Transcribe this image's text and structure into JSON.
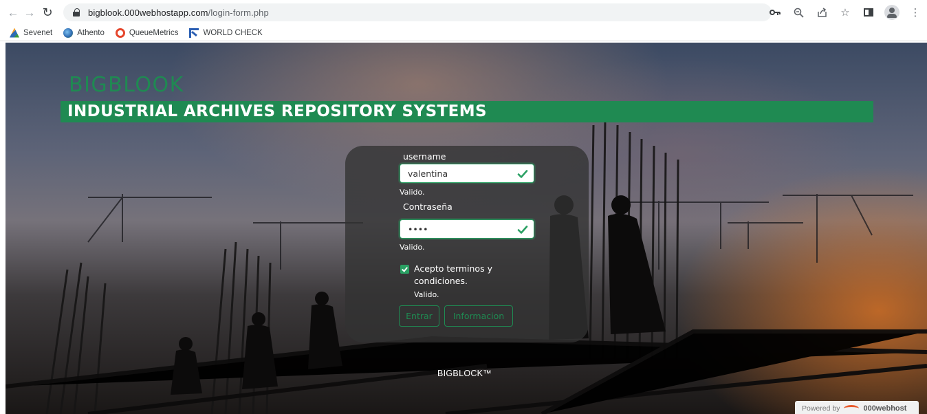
{
  "browser": {
    "url_host": "bigblook.000webhostapp.com",
    "url_path": "/login-form.php",
    "bookmarks": [
      {
        "label": "Sevenet",
        "icon": "sevenet-icon"
      },
      {
        "label": "Athento",
        "icon": "athento-icon"
      },
      {
        "label": "QueueMetrics",
        "icon": "queuemetrics-icon"
      },
      {
        "label": "WORLD CHECK",
        "icon": "world-check-icon"
      }
    ],
    "icons": [
      "back-icon",
      "forward-icon",
      "reload-icon",
      "lock-icon",
      "key-icon",
      "zoom-icon",
      "share-icon",
      "star-icon",
      "side-panel-icon",
      "profile-icon",
      "menu-icon"
    ]
  },
  "page": {
    "brand": "BIGBLOOK",
    "banner": "INDUSTRIAL ARCHIVES REPOSITORY SYSTEMS",
    "form": {
      "username_label": "username",
      "username_value": "valentina",
      "username_valid": "Valido.",
      "password_label": "Contraseña",
      "password_value": "••••",
      "password_valid": "Valido.",
      "terms_label": "Acepto terminos y condiciones.",
      "terms_checked": true,
      "terms_valid": "Valido.",
      "submit_label": "Entrar",
      "info_label": "Informacion"
    },
    "footer_brand": "BIGBLOCK™",
    "powered_by": "Powered by",
    "powered_host": "000webhost"
  },
  "colors": {
    "accent_green": "#1f8a52",
    "valid_green": "#2aa063",
    "card_bg": "rgba(50,50,50,0.78)"
  }
}
